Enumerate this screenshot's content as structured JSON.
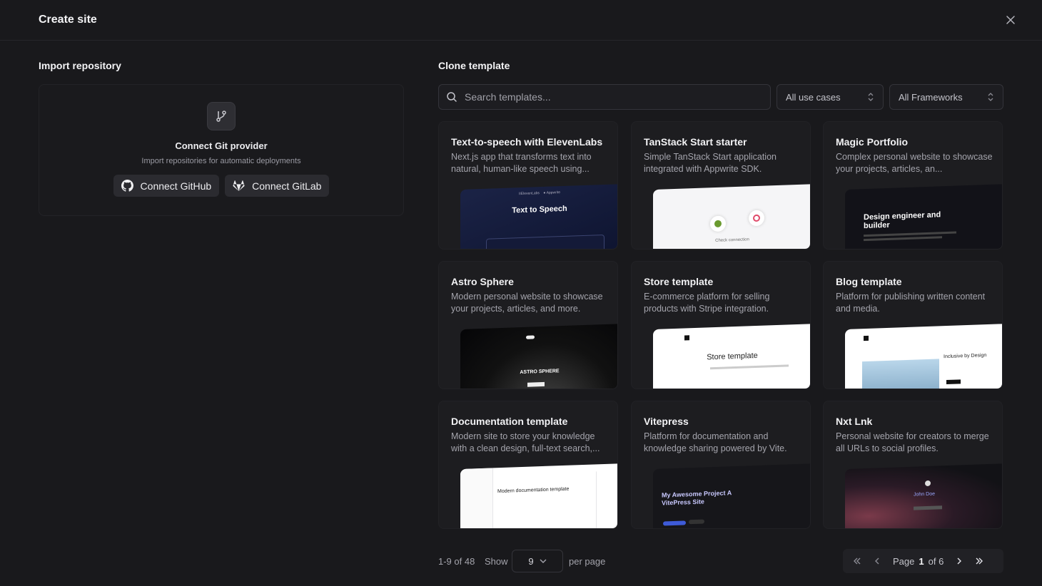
{
  "dialog": {
    "title": "Create site"
  },
  "import": {
    "heading": "Import repository",
    "card_title": "Connect Git provider",
    "card_subtitle": "Import repositories for automatic deployments",
    "github_label": "Connect GitHub",
    "gitlab_label": "Connect GitLab"
  },
  "clone": {
    "heading": "Clone template",
    "search_placeholder": "Search templates...",
    "use_case_filter": "All use cases",
    "framework_filter": "All Frameworks"
  },
  "templates": [
    {
      "title": "Text-to-speech with ElevenLabs",
      "desc": "Next.js app that transforms text into natural, human-like speech using...",
      "preview_text": "Text to Speech"
    },
    {
      "title": "TanStack Start starter",
      "desc": "Simple TanStack Start application integrated with Appwrite SDK.",
      "preview_text": "Check connection"
    },
    {
      "title": "Magic Portfolio",
      "desc": "Complex personal website to showcase your projects, articles, an...",
      "preview_text": "Design engineer and builder"
    },
    {
      "title": "Astro Sphere",
      "desc": "Modern personal website to showcase your projects, articles, and more.",
      "preview_text": "ASTRO SPHERE"
    },
    {
      "title": "Store template",
      "desc": "E-commerce platform for selling products with Stripe integration.",
      "preview_text": "Store template"
    },
    {
      "title": "Blog template",
      "desc": "Platform for publishing written content and media.",
      "preview_text": "Inclusive by Design"
    },
    {
      "title": "Documentation template",
      "desc": "Modern site to store your knowledge with a clean design, full-text search,...",
      "preview_text": "Modern documentation template"
    },
    {
      "title": "Vitepress",
      "desc": "Platform for documentation and knowledge sharing powered by Vite.",
      "preview_text": "My Awesome Project A VitePress Site"
    },
    {
      "title": "Nxt Lnk",
      "desc": "Personal website for creators to merge all URLs to social profiles.",
      "preview_text": "John Doe"
    }
  ],
  "footer": {
    "range": "1-9 of 48",
    "show_label": "Show",
    "per_page_value": "9",
    "per_page_label": "per page",
    "page_label": "Page",
    "page_current": "1",
    "page_total": "of 6"
  },
  "colors": {
    "background": "#19191c",
    "card": "#1d1d20",
    "accent_blue": "#3e5bd8"
  }
}
